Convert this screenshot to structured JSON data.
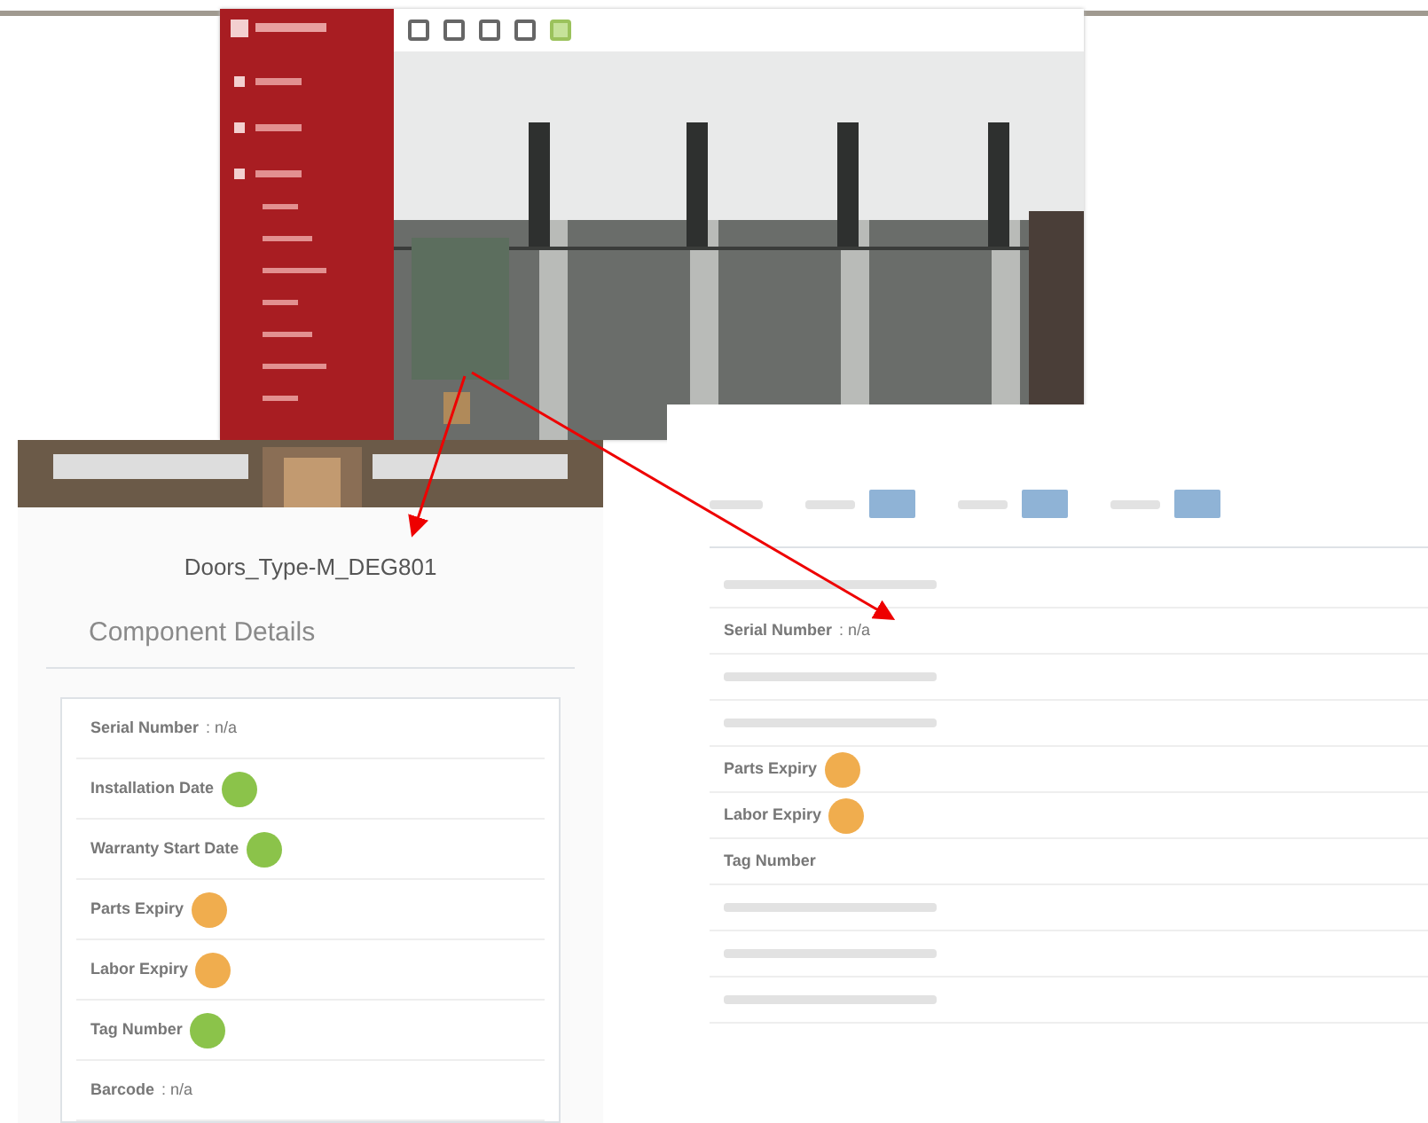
{
  "viewer": {
    "toolbar_tools": [
      {
        "selected": false
      },
      {
        "selected": false
      },
      {
        "selected": false
      },
      {
        "selected": false
      },
      {
        "selected": true
      }
    ]
  },
  "component_card": {
    "title": "Doors_Type-M_DEG801",
    "section": "Component Details",
    "rows": [
      {
        "kind": "field",
        "label": "Serial Number",
        "value": ": n/a"
      },
      {
        "kind": "field",
        "label": "Installation Date",
        "color": "#8bc34a"
      },
      {
        "kind": "field",
        "label": "Warranty Start Date",
        "color": "#8bc34a"
      },
      {
        "kind": "field",
        "label": "Parts Expiry",
        "color": "#f0ad4e"
      },
      {
        "kind": "field",
        "label": "Labor Expiry",
        "color": "#f0ad4e"
      },
      {
        "kind": "field",
        "label": "Tag Number",
        "color": "#8bc34a"
      },
      {
        "kind": "field",
        "label": "Barcode",
        "value": ": n/a"
      }
    ]
  },
  "detail_panel": {
    "filters": [
      {
        "selected": false
      },
      {
        "selected": false
      },
      {
        "selected": false
      }
    ],
    "rows": [
      {
        "kind": "blurred"
      },
      {
        "kind": "field",
        "label": "Serial Number",
        "value": ": n/a"
      },
      {
        "kind": "blurred"
      },
      {
        "kind": "blurred"
      },
      {
        "kind": "field",
        "label": "Parts Expiry",
        "color": "#f0ad4e"
      },
      {
        "kind": "field",
        "label": "Labor Expiry",
        "color": "#f0ad4e"
      },
      {
        "kind": "field",
        "label": "Tag Number"
      },
      {
        "kind": "blurred"
      },
      {
        "kind": "blurred"
      },
      {
        "kind": "blurred"
      }
    ]
  }
}
